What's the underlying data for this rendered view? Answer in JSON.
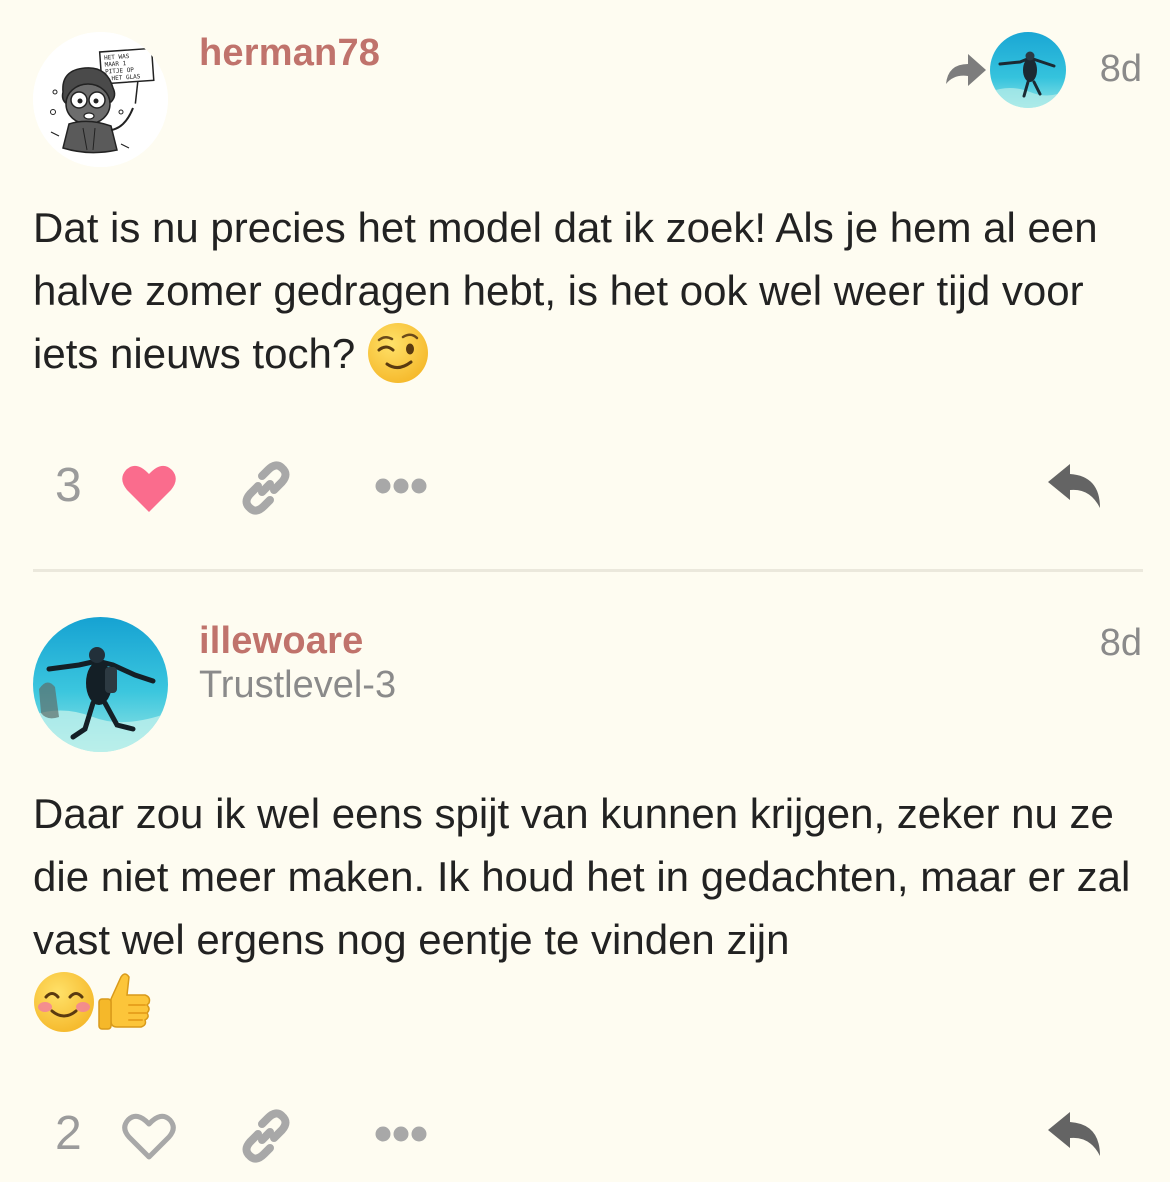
{
  "posts": [
    {
      "username": "herman78",
      "time": "8d",
      "content": "Dat is nu precies het model dat ik zoek! Als je hem al een halve zomer gedragen hebt, is het ook wel weer tijd voor iets nieuws toch?",
      "emojis": [
        "winking-face"
      ],
      "like_count": "3",
      "liked": true,
      "avatar_sign_text": [
        "HET WAS",
        "MAAR 1",
        "PITJE OP",
        "HET GLAS"
      ],
      "reply_to_avatar": "diver-avatar"
    },
    {
      "username": "illewoare",
      "user_title": "Trustlevel-3",
      "time": "8d",
      "content": "Daar zou ik wel eens spijt van kunnen krijgen, zeker nu ze die niet meer maken. Ik houd het in gedachten, maar er zal vast wel ergens nog eentje te vinden zijn",
      "emojis": [
        "smiling-face-with-smiling-eyes",
        "thumbs-up"
      ],
      "like_count": "2",
      "liked": false
    }
  ],
  "colors": {
    "background": "#fefcf1",
    "username": "#c0736c",
    "muted": "#8a8a8a",
    "like_active": "#fa6c8d",
    "icon": "#9b9b9b",
    "reply_icon": "#646464"
  }
}
